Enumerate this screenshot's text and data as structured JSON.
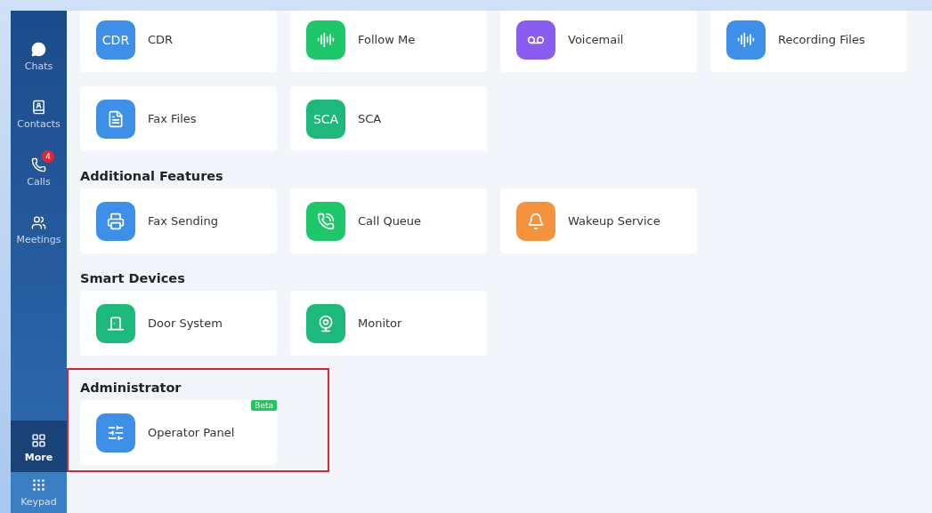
{
  "sidebar": {
    "items": [
      {
        "label": "Chats",
        "selected": false
      },
      {
        "label": "Contacts",
        "selected": false
      },
      {
        "label": "Calls",
        "selected": false,
        "badge": "4"
      },
      {
        "label": "Meetings",
        "selected": false
      }
    ],
    "bottom_items": [
      {
        "label": "More",
        "selected": true
      },
      {
        "label": "Keypad",
        "selected": false
      }
    ]
  },
  "sections": [
    {
      "items": [
        {
          "label": "CDR",
          "kind": "text",
          "icon_text": "CDR",
          "color": "#3d8fe8"
        },
        {
          "label": "Follow Me",
          "kind": "glyph",
          "color": "#1ec76a"
        },
        {
          "label": "Voicemail",
          "kind": "glyph",
          "color": "#8a5cf0"
        },
        {
          "label": "Recording Files",
          "kind": "glyph",
          "color": "#3d8fe8"
        },
        {
          "label": "Fax Files",
          "kind": "glyph",
          "color": "#3d8fe8"
        },
        {
          "label": "SCA",
          "kind": "text",
          "icon_text": "SCA",
          "color": "#1db97a"
        }
      ]
    },
    {
      "title": "Additional Features",
      "items": [
        {
          "label": "Fax Sending",
          "kind": "glyph",
          "color": "#3d8fe8"
        },
        {
          "label": "Call Queue",
          "kind": "glyph",
          "color": "#1ec76a"
        },
        {
          "label": "Wakeup Service",
          "kind": "glyph",
          "color": "#f5923e"
        }
      ]
    },
    {
      "title": "Smart Devices",
      "items": [
        {
          "label": "Door System",
          "kind": "glyph",
          "color": "#1db97a"
        },
        {
          "label": "Monitor",
          "kind": "glyph",
          "color": "#1db97a"
        }
      ]
    },
    {
      "title": "Administrator",
      "highlighted": true,
      "items": [
        {
          "label": "Operator Panel",
          "kind": "glyph",
          "color": "#3d8fe8",
          "tag": "Beta"
        }
      ]
    }
  ]
}
